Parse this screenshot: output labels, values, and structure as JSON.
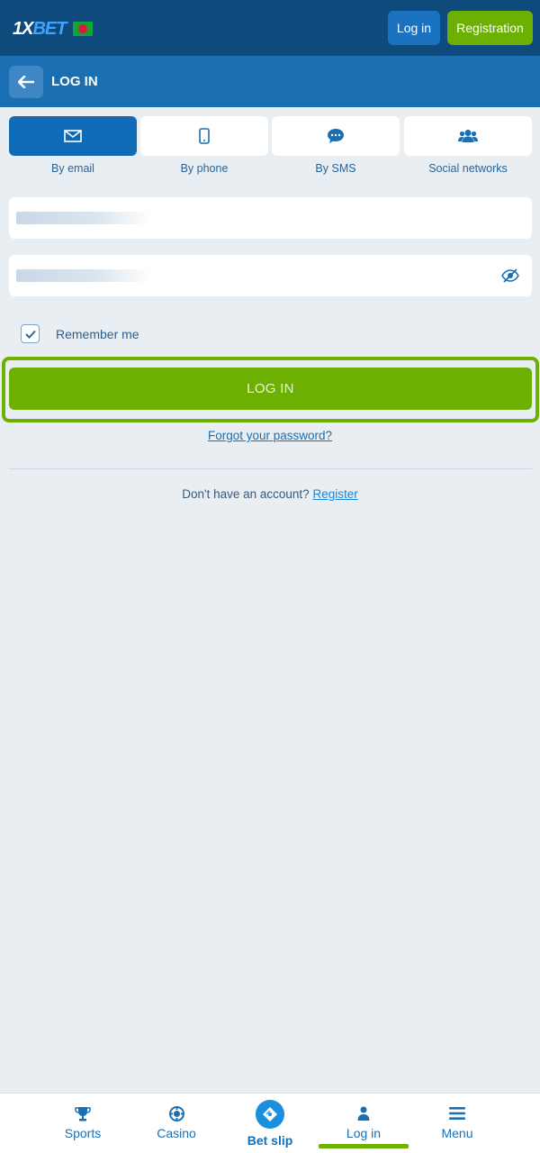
{
  "header": {
    "logo_prefix": "1X",
    "logo_suffix": "BET",
    "login_label": "Log in",
    "registration_label": "Registration"
  },
  "subheader": {
    "title": "LOG IN"
  },
  "tabs": [
    {
      "label": "By email",
      "icon": "envelope-icon",
      "active": true
    },
    {
      "label": "By phone",
      "icon": "phone-icon",
      "active": false
    },
    {
      "label": "By SMS",
      "icon": "chat-icon",
      "active": false
    },
    {
      "label": "Social networks",
      "icon": "users-icon",
      "active": false
    }
  ],
  "form": {
    "email_value": "",
    "password_value": "",
    "remember_label": "Remember me",
    "remember_checked": true,
    "submit_label": "LOG IN",
    "forgot_label": "Forgot your password?",
    "no_account_text": "Don't have an account?",
    "register_link": "Register"
  },
  "bottom_nav": [
    {
      "label": "Sports",
      "icon": "trophy-icon"
    },
    {
      "label": "Casino",
      "icon": "casino-chip-icon"
    },
    {
      "label": "Bet slip",
      "icon": "ticket-icon"
    },
    {
      "label": "Log in",
      "icon": "user-icon",
      "active": true
    },
    {
      "label": "Menu",
      "icon": "menu-icon"
    }
  ],
  "colors": {
    "primary_dark": "#0f4a7c",
    "primary": "#1a6fb2",
    "accent_green": "#6cb002",
    "background": "#e9eef3"
  }
}
